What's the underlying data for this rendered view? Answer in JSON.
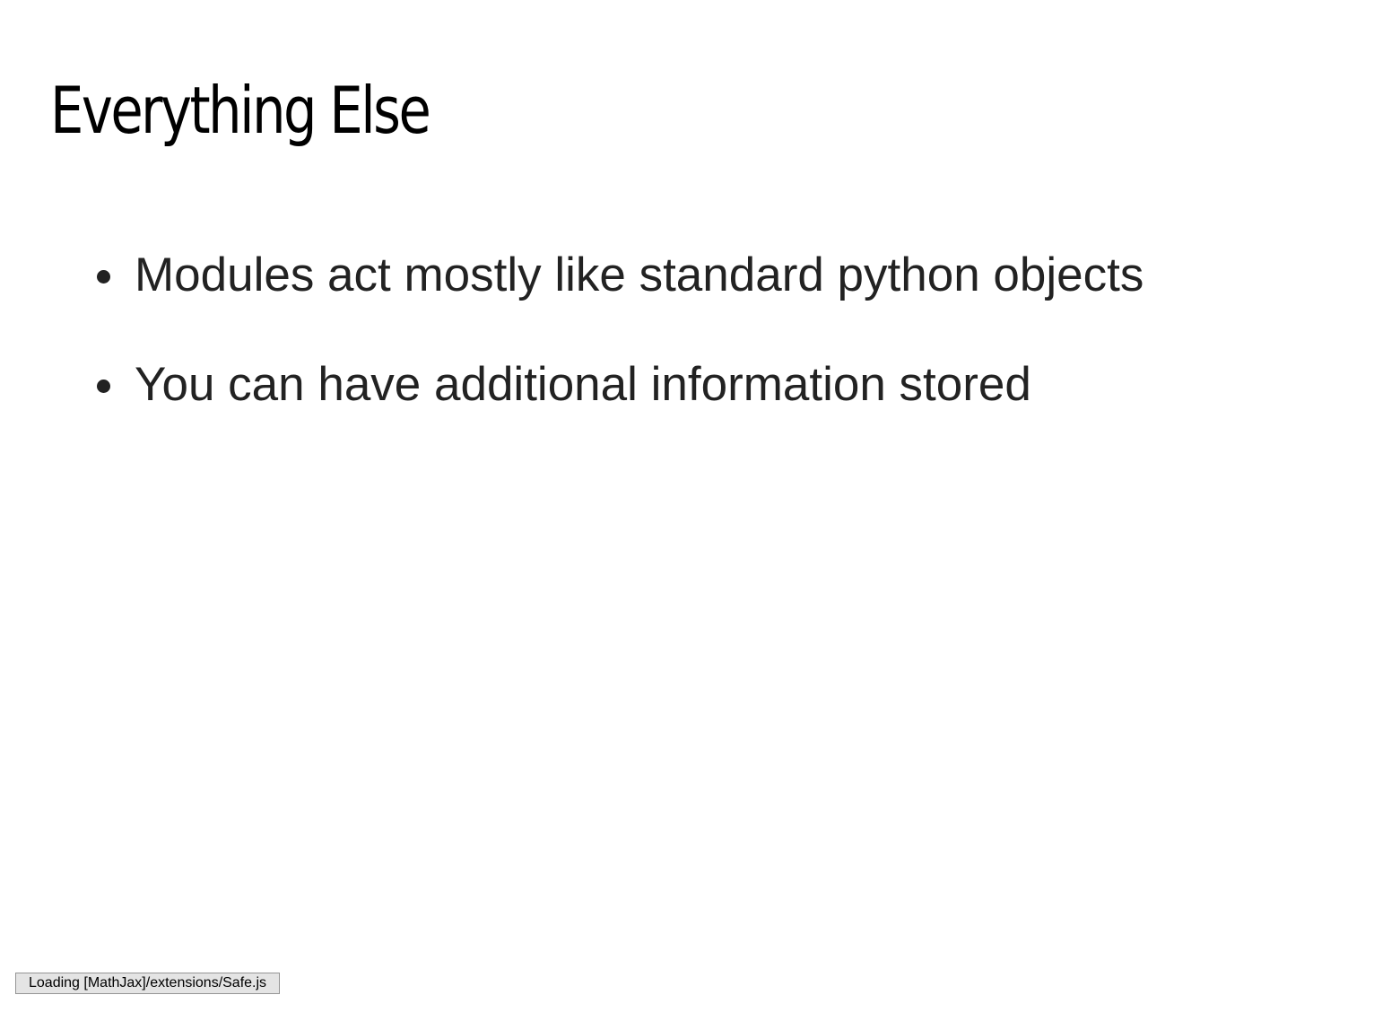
{
  "slide": {
    "title": "Everything Else",
    "bullets": [
      "Modules act mostly like standard python objects",
      "You can have additional information stored"
    ]
  },
  "status": {
    "message": "Loading [MathJax]/extensions/Safe.js"
  }
}
